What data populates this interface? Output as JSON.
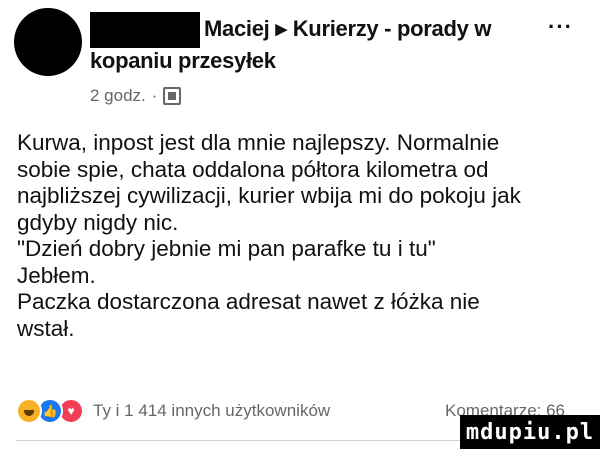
{
  "post": {
    "author_name": "Maciej",
    "group_name_line1": "Kurierzy - porady w",
    "group_name_line2": "kopaniu przesyłek",
    "time": "2 godz.",
    "dot": "·",
    "more_label": "···",
    "separator_icon": "triangle-right-icon",
    "audience_icon": "group-audience-icon",
    "body_lines": [
      "Kurwa, inpost jest dla mnie najlepszy. Normalnie",
      "sobie spie, chata oddalona półtora kilometra od",
      "najbliższej cywilizacji, kurier wbija mi do pokoju jak",
      "gdyby nigdy nic.",
      "\"Dzień dobry jebnie mi pan parafke tu i tu\"",
      "Jebłem.",
      "Paczka dostarczona adresat nawet z łóżka nie",
      "wstał."
    ]
  },
  "footer": {
    "reactions": [
      "haha",
      "like",
      "love"
    ],
    "reaction_text": "Ty i 1 414 innych użytkowników",
    "comments_text": "Komentarze: 66"
  },
  "watermark": "mdupiu.pl",
  "colors": {
    "text": "#050505",
    "meta": "#65676b",
    "like": "#1877f2",
    "love": "#f33e58",
    "haha": "#f7b125"
  }
}
